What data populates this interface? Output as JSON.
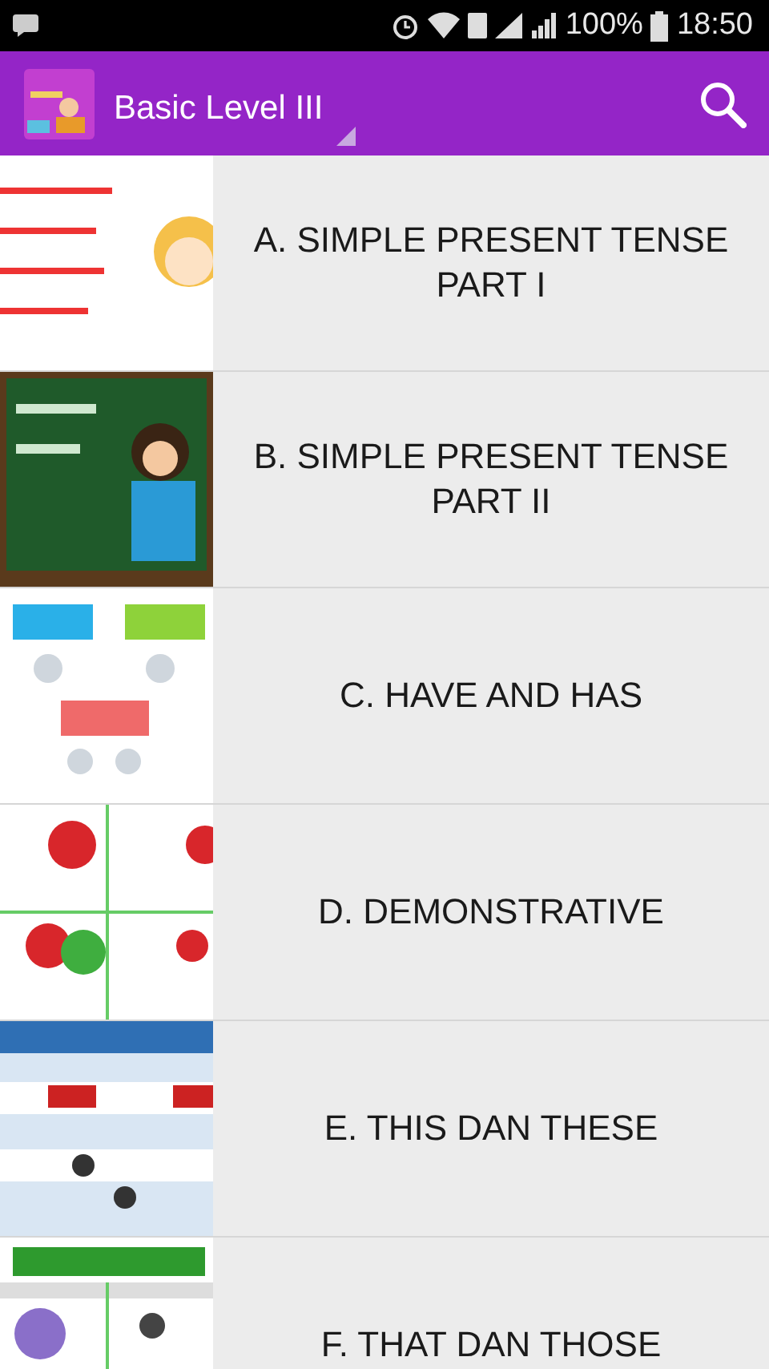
{
  "status_bar": {
    "battery": "100%",
    "time": "18:50"
  },
  "app_bar": {
    "title": "Basic Level III"
  },
  "lessons": [
    {
      "title": "A. SIMPLE PRESENT TENSE PART I"
    },
    {
      "title": "B. SIMPLE PRESENT TENSE PART II"
    },
    {
      "title": "C. HAVE AND HAS"
    },
    {
      "title": "D. DEMONSTRATIVE"
    },
    {
      "title": "E. THIS DAN THESE"
    },
    {
      "title": "F. THAT DAN THOSE"
    }
  ]
}
